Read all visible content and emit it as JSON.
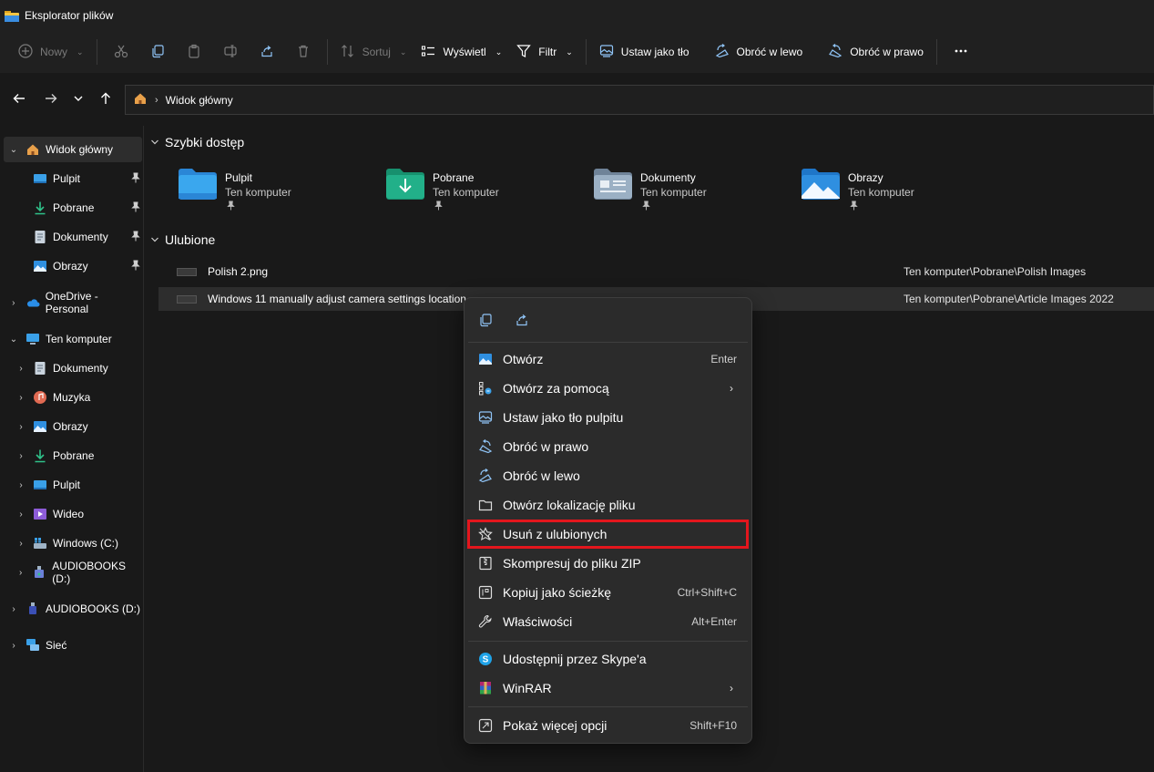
{
  "window": {
    "title": "Eksplorator plików"
  },
  "toolbar": {
    "new_label": "Nowy",
    "sort_label": "Sortuj",
    "view_label": "Wyświetl",
    "filter_label": "Filtr",
    "set_bg_label": "Ustaw jako tło",
    "rotate_left_label": "Obróć w lewo",
    "rotate_right_label": "Obróć w prawo"
  },
  "address": {
    "crumb": "Widok główny"
  },
  "sidebar": {
    "items": [
      {
        "label": "Widok główny",
        "icon": "home-icon"
      },
      {
        "label": "Pulpit",
        "icon": "desktop-icon"
      },
      {
        "label": "Pobrane",
        "icon": "download-icon"
      },
      {
        "label": "Dokumenty",
        "icon": "document-icon"
      },
      {
        "label": "Obrazy",
        "icon": "pictures-icon"
      },
      {
        "label": "OneDrive - Personal",
        "icon": "cloud-icon"
      },
      {
        "label": "Ten komputer",
        "icon": "computer-icon"
      },
      {
        "label": "Dokumenty",
        "icon": "document-icon"
      },
      {
        "label": "Muzyka",
        "icon": "music-icon"
      },
      {
        "label": "Obrazy",
        "icon": "pictures-icon"
      },
      {
        "label": "Pobrane",
        "icon": "download-icon"
      },
      {
        "label": "Pulpit",
        "icon": "desktop-icon"
      },
      {
        "label": "Wideo",
        "icon": "video-icon"
      },
      {
        "label": "Windows (C:)",
        "icon": "drive-icon"
      },
      {
        "label": "AUDIOBOOKS (D:)",
        "icon": "usb-drive-icon"
      },
      {
        "label": "AUDIOBOOKS (D:)",
        "icon": "usb-drive-icon"
      },
      {
        "label": "Sieć",
        "icon": "network-icon"
      }
    ]
  },
  "quick_access": {
    "heading": "Szybki dostęp",
    "tiles": [
      {
        "name": "Pulpit",
        "sub": "Ten komputer",
        "color": "#3aa0e8"
      },
      {
        "name": "Pobrane",
        "sub": "Ten komputer",
        "color": "#1fa37f"
      },
      {
        "name": "Dokumenty",
        "sub": "Ten komputer",
        "color": "#8fa3b8"
      },
      {
        "name": "Obrazy",
        "sub": "Ten komputer",
        "color": "#2f8fe0"
      }
    ]
  },
  "favorites": {
    "heading": "Ulubione",
    "rows": [
      {
        "name": "Polish 2.png",
        "path": "Ten komputer\\Pobrane\\Polish Images"
      },
      {
        "name": "Windows 11 manually adjust camera settings location",
        "path": "Ten komputer\\Pobrane\\Article Images 2022"
      }
    ]
  },
  "context_menu": {
    "items": [
      {
        "label": "Otwórz",
        "shortcut": "Enter",
        "icon": "image-icon"
      },
      {
        "label": "Otwórz za pomocą",
        "shortcut": "",
        "icon": "open-with-icon"
      },
      {
        "label": "Ustaw jako tło pulpitu",
        "shortcut": "",
        "icon": "wallpaper-icon"
      },
      {
        "label": "Obróć w prawo",
        "shortcut": "",
        "icon": "rotate-right-icon"
      },
      {
        "label": "Obróć w lewo",
        "shortcut": "",
        "icon": "rotate-left-icon"
      },
      {
        "label": "Otwórz lokalizację pliku",
        "shortcut": "",
        "icon": "folder-open-icon"
      },
      {
        "label": "Usuń z ulubionych",
        "shortcut": "",
        "icon": "star-icon"
      },
      {
        "label": "Skompresuj do pliku ZIP",
        "shortcut": "",
        "icon": "zip-icon"
      },
      {
        "label": "Kopiuj jako ścieżkę",
        "shortcut": "Ctrl+Shift+C",
        "icon": "copy-path-icon"
      },
      {
        "label": "Właściwości",
        "shortcut": "Alt+Enter",
        "icon": "wrench-icon"
      },
      {
        "label": "Udostępnij przez Skype'a",
        "shortcut": "",
        "icon": "skype-icon"
      },
      {
        "label": "WinRAR",
        "shortcut": "",
        "icon": "winrar-icon"
      },
      {
        "label": "Pokaż więcej opcji",
        "shortcut": "Shift+F10",
        "icon": "more-options-icon"
      }
    ]
  },
  "colors": {
    "highlight": "#e3161d",
    "accent": "#3aa0e8"
  }
}
